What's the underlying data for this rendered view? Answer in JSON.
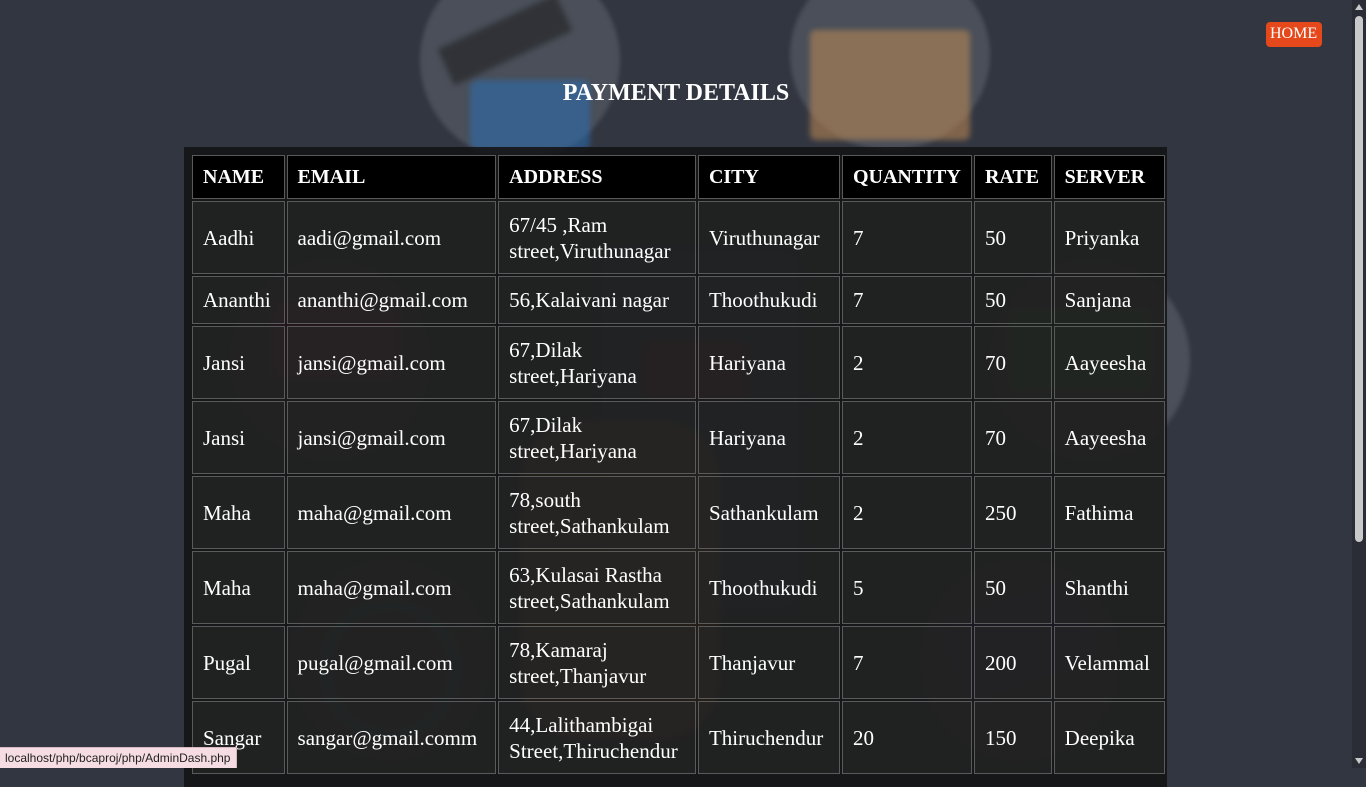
{
  "nav": {
    "home_label": "HOME"
  },
  "page": {
    "title": "PAYMENT DETAILS"
  },
  "table": {
    "headers": [
      "NAME",
      "EMAIL",
      "ADDRESS",
      "CITY",
      "QUANTITY",
      "RATE",
      "SERVER"
    ],
    "rows": [
      {
        "name": "Aadhi",
        "email": "aadi@gmail.com",
        "address": "67/45 ,Ram street,Viruthunagar",
        "city": "Viruthunagar",
        "quantity": "7",
        "rate": "50",
        "server": "Priyanka"
      },
      {
        "name": "Ananthi",
        "email": "ananthi@gmail.com",
        "address": "56,Kalaivani nagar",
        "city": "Thoothukudi",
        "quantity": "7",
        "rate": "50",
        "server": "Sanjana"
      },
      {
        "name": "Jansi",
        "email": "jansi@gmail.com",
        "address": "67,Dilak street,Hariyana",
        "city": "Hariyana",
        "quantity": "2",
        "rate": "70",
        "server": "Aayeesha"
      },
      {
        "name": "Jansi",
        "email": "jansi@gmail.com",
        "address": "67,Dilak street,Hariyana",
        "city": "Hariyana",
        "quantity": "2",
        "rate": "70",
        "server": "Aayeesha"
      },
      {
        "name": "Maha",
        "email": "maha@gmail.com",
        "address": "78,south street,Sathankulam",
        "city": "Sathankulam",
        "quantity": "2",
        "rate": "250",
        "server": "Fathima"
      },
      {
        "name": "Maha",
        "email": "maha@gmail.com",
        "address": "63,Kulasai Rastha street,Sathankulam",
        "city": "Thoothukudi",
        "quantity": "5",
        "rate": "50",
        "server": "Shanthi"
      },
      {
        "name": "Pugal",
        "email": "pugal@gmail.com",
        "address": "78,Kamaraj street,Thanjavur",
        "city": "Thanjavur",
        "quantity": "7",
        "rate": "200",
        "server": "Velammal"
      },
      {
        "name": "Sangar",
        "email": "sangar@gmail.comm",
        "address": "44,Lalithambigai Street,Thiruchendur",
        "city": "Thiruchendur",
        "quantity": "20",
        "rate": "150",
        "server": "Deepika"
      }
    ]
  },
  "status_bar": {
    "url": "localhost/php/bcaproj/php/AdminDash.php"
  },
  "colors": {
    "background": "#323641",
    "home_button": "#e5481b",
    "table_header": "#000000"
  }
}
